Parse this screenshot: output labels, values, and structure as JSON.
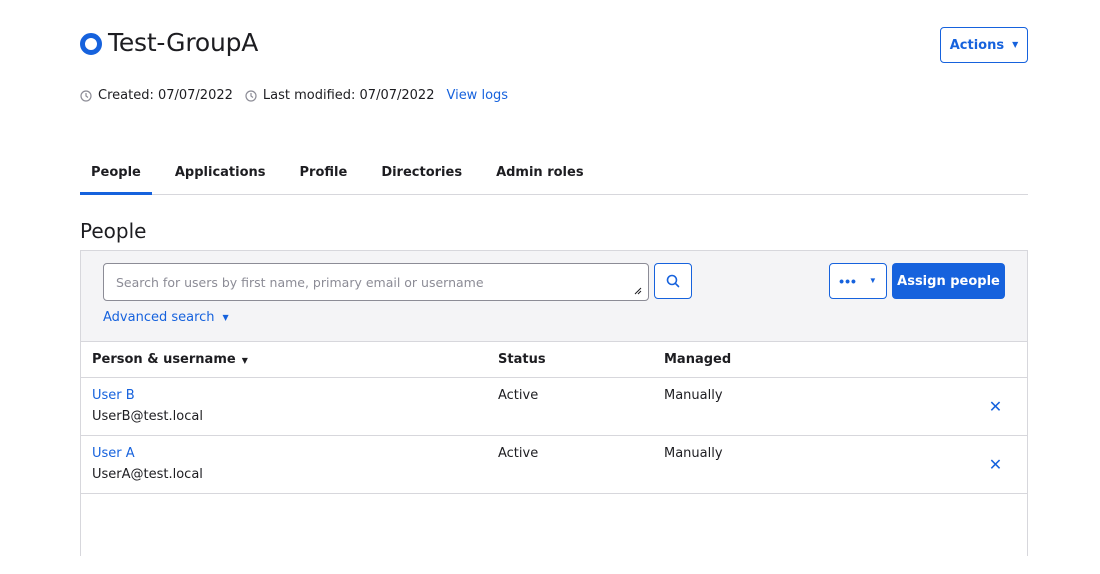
{
  "header": {
    "title": "Test-GroupA",
    "actions_label": "Actions"
  },
  "meta": {
    "created": "Created: 07/07/2022",
    "modified": "Last modified: 07/07/2022",
    "view_logs": "View logs"
  },
  "tabs": [
    {
      "label": "People",
      "active": true
    },
    {
      "label": "Applications",
      "active": false
    },
    {
      "label": "Profile",
      "active": false
    },
    {
      "label": "Directories",
      "active": false
    },
    {
      "label": "Admin roles",
      "active": false
    }
  ],
  "section": {
    "title": "People"
  },
  "toolbar": {
    "search_placeholder": "Search for users by first name, primary email or username",
    "search_value": "",
    "advanced_search": "Advanced search",
    "more_label": "•••",
    "assign_label": "Assign people"
  },
  "table": {
    "columns": [
      "Person & username",
      "Status",
      "Managed"
    ],
    "rows": [
      {
        "name": "User B",
        "email": "UserB@test.local",
        "status": "Active",
        "managed": "Manually"
      },
      {
        "name": "User A",
        "email": "UserA@test.local",
        "status": "Active",
        "managed": "Manually"
      }
    ]
  },
  "colors": {
    "accent": "#1662dd",
    "border": "#d7d7dc",
    "panel_bg": "#f4f4f6"
  },
  "icons": {
    "group": "group-ring-icon",
    "clock": "clock-icon",
    "search": "search-icon",
    "remove": "close-icon"
  }
}
